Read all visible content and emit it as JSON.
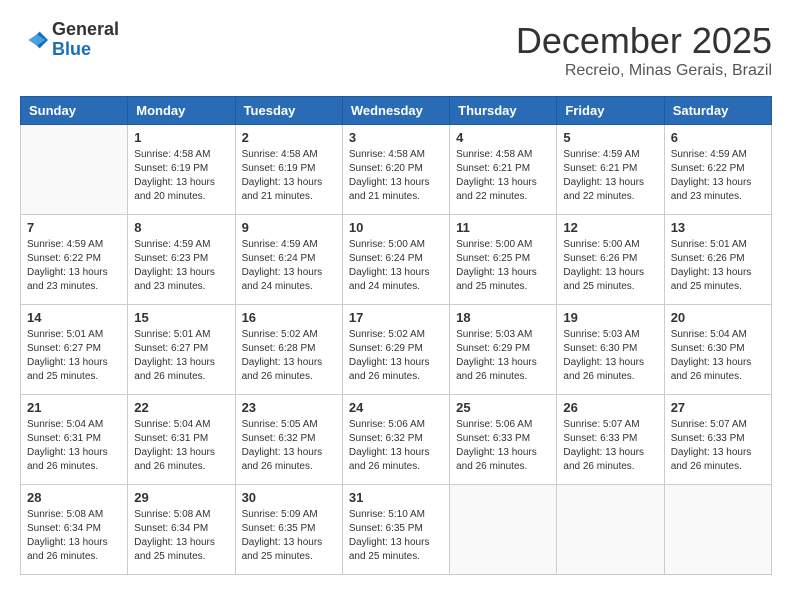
{
  "header": {
    "logo_general": "General",
    "logo_blue": "Blue",
    "month_title": "December 2025",
    "subtitle": "Recreio, Minas Gerais, Brazil"
  },
  "weekdays": [
    "Sunday",
    "Monday",
    "Tuesday",
    "Wednesday",
    "Thursday",
    "Friday",
    "Saturday"
  ],
  "weeks": [
    [
      {
        "day": "",
        "empty": true
      },
      {
        "day": "1",
        "sunrise": "4:58 AM",
        "sunset": "6:19 PM",
        "daylight": "13 hours and 20 minutes."
      },
      {
        "day": "2",
        "sunrise": "4:58 AM",
        "sunset": "6:19 PM",
        "daylight": "13 hours and 21 minutes."
      },
      {
        "day": "3",
        "sunrise": "4:58 AM",
        "sunset": "6:20 PM",
        "daylight": "13 hours and 21 minutes."
      },
      {
        "day": "4",
        "sunrise": "4:58 AM",
        "sunset": "6:21 PM",
        "daylight": "13 hours and 22 minutes."
      },
      {
        "day": "5",
        "sunrise": "4:59 AM",
        "sunset": "6:21 PM",
        "daylight": "13 hours and 22 minutes."
      },
      {
        "day": "6",
        "sunrise": "4:59 AM",
        "sunset": "6:22 PM",
        "daylight": "13 hours and 23 minutes."
      }
    ],
    [
      {
        "day": "7",
        "sunrise": "4:59 AM",
        "sunset": "6:22 PM",
        "daylight": "13 hours and 23 minutes."
      },
      {
        "day": "8",
        "sunrise": "4:59 AM",
        "sunset": "6:23 PM",
        "daylight": "13 hours and 23 minutes."
      },
      {
        "day": "9",
        "sunrise": "4:59 AM",
        "sunset": "6:24 PM",
        "daylight": "13 hours and 24 minutes."
      },
      {
        "day": "10",
        "sunrise": "5:00 AM",
        "sunset": "6:24 PM",
        "daylight": "13 hours and 24 minutes."
      },
      {
        "day": "11",
        "sunrise": "5:00 AM",
        "sunset": "6:25 PM",
        "daylight": "13 hours and 25 minutes."
      },
      {
        "day": "12",
        "sunrise": "5:00 AM",
        "sunset": "6:26 PM",
        "daylight": "13 hours and 25 minutes."
      },
      {
        "day": "13",
        "sunrise": "5:01 AM",
        "sunset": "6:26 PM",
        "daylight": "13 hours and 25 minutes."
      }
    ],
    [
      {
        "day": "14",
        "sunrise": "5:01 AM",
        "sunset": "6:27 PM",
        "daylight": "13 hours and 25 minutes."
      },
      {
        "day": "15",
        "sunrise": "5:01 AM",
        "sunset": "6:27 PM",
        "daylight": "13 hours and 26 minutes."
      },
      {
        "day": "16",
        "sunrise": "5:02 AM",
        "sunset": "6:28 PM",
        "daylight": "13 hours and 26 minutes."
      },
      {
        "day": "17",
        "sunrise": "5:02 AM",
        "sunset": "6:29 PM",
        "daylight": "13 hours and 26 minutes."
      },
      {
        "day": "18",
        "sunrise": "5:03 AM",
        "sunset": "6:29 PM",
        "daylight": "13 hours and 26 minutes."
      },
      {
        "day": "19",
        "sunrise": "5:03 AM",
        "sunset": "6:30 PM",
        "daylight": "13 hours and 26 minutes."
      },
      {
        "day": "20",
        "sunrise": "5:04 AM",
        "sunset": "6:30 PM",
        "daylight": "13 hours and 26 minutes."
      }
    ],
    [
      {
        "day": "21",
        "sunrise": "5:04 AM",
        "sunset": "6:31 PM",
        "daylight": "13 hours and 26 minutes."
      },
      {
        "day": "22",
        "sunrise": "5:04 AM",
        "sunset": "6:31 PM",
        "daylight": "13 hours and 26 minutes."
      },
      {
        "day": "23",
        "sunrise": "5:05 AM",
        "sunset": "6:32 PM",
        "daylight": "13 hours and 26 minutes."
      },
      {
        "day": "24",
        "sunrise": "5:06 AM",
        "sunset": "6:32 PM",
        "daylight": "13 hours and 26 minutes."
      },
      {
        "day": "25",
        "sunrise": "5:06 AM",
        "sunset": "6:33 PM",
        "daylight": "13 hours and 26 minutes."
      },
      {
        "day": "26",
        "sunrise": "5:07 AM",
        "sunset": "6:33 PM",
        "daylight": "13 hours and 26 minutes."
      },
      {
        "day": "27",
        "sunrise": "5:07 AM",
        "sunset": "6:33 PM",
        "daylight": "13 hours and 26 minutes."
      }
    ],
    [
      {
        "day": "28",
        "sunrise": "5:08 AM",
        "sunset": "6:34 PM",
        "daylight": "13 hours and 26 minutes."
      },
      {
        "day": "29",
        "sunrise": "5:08 AM",
        "sunset": "6:34 PM",
        "daylight": "13 hours and 25 minutes."
      },
      {
        "day": "30",
        "sunrise": "5:09 AM",
        "sunset": "6:35 PM",
        "daylight": "13 hours and 25 minutes."
      },
      {
        "day": "31",
        "sunrise": "5:10 AM",
        "sunset": "6:35 PM",
        "daylight": "13 hours and 25 minutes."
      },
      {
        "day": "",
        "empty": true
      },
      {
        "day": "",
        "empty": true
      },
      {
        "day": "",
        "empty": true
      }
    ]
  ],
  "labels": {
    "sunrise_prefix": "Sunrise: ",
    "sunset_prefix": "Sunset: ",
    "daylight_prefix": "Daylight: "
  }
}
